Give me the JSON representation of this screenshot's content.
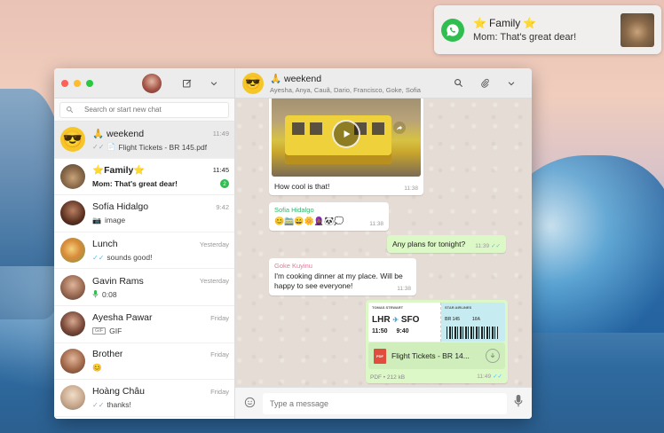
{
  "notification": {
    "title": "Family",
    "body": "Mom: That's great dear!"
  },
  "sidebar": {
    "search_placeholder": "Search or start new chat",
    "chats": [
      {
        "name": "weekend",
        "time": "11:49",
        "message": "Flight Tickets - BR 145.pdf",
        "avatar": "sunglasses-emoji"
      },
      {
        "name": "Family",
        "time": "11:45",
        "message": "Mom: That's great dear!",
        "unread": "2"
      },
      {
        "name": "Sofía Hidalgo",
        "time": "9:42",
        "message": "image"
      },
      {
        "name": "Lunch",
        "time": "Yesterday",
        "message": "sounds good!"
      },
      {
        "name": "Gavin Rams",
        "time": "Yesterday",
        "message": "0:08"
      },
      {
        "name": "Ayesha Pawar",
        "time": "Friday",
        "message": "GIF"
      },
      {
        "name": "Brother",
        "time": "Friday",
        "message": "😊"
      },
      {
        "name": "Hoàng Châu",
        "time": "Friday",
        "message": "thanks!"
      }
    ]
  },
  "conversation": {
    "title": "weekend",
    "participants": "Ayesha, Anya, Cauã, Dario, Francisco, Goke, Sofia",
    "composer_placeholder": "Type a message",
    "messages": [
      {
        "kind": "video",
        "text": "How cool is that!",
        "time": "11:38"
      },
      {
        "kind": "text",
        "sender": "Sofia Hidalgo",
        "text": "😊🚞😄🌼🧕🏾🐼💭",
        "time": "11:38"
      },
      {
        "kind": "text",
        "text": "Any plans for tonight?",
        "time": "11:39",
        "ticks": "✓✓"
      },
      {
        "kind": "text",
        "sender": "Goke Kuyinu",
        "text": "I'm cooking dinner at my place. Will be happy to see everyone!",
        "time": "11:38"
      },
      {
        "kind": "file",
        "file_name": "Flight Tickets - BR 14...",
        "file_meta": "PDF • 212 kB",
        "time": "11:49",
        "ticks": "✓✓",
        "ticket": {
          "passenger": "TOMAS STEWART",
          "airline": "STAR AIRLINES",
          "route_from": "LHR",
          "route_to": "SFO",
          "flight": "BR 145",
          "seat": "10A",
          "depart": "11:50",
          "arrive": "9:40"
        }
      }
    ]
  },
  "colors": {
    "accent": "#2fbe4f",
    "outgoing_bubble": "#dcf8c6",
    "chat_bg": "#e5ddd5",
    "read_ticks": "#4fc3f7"
  }
}
